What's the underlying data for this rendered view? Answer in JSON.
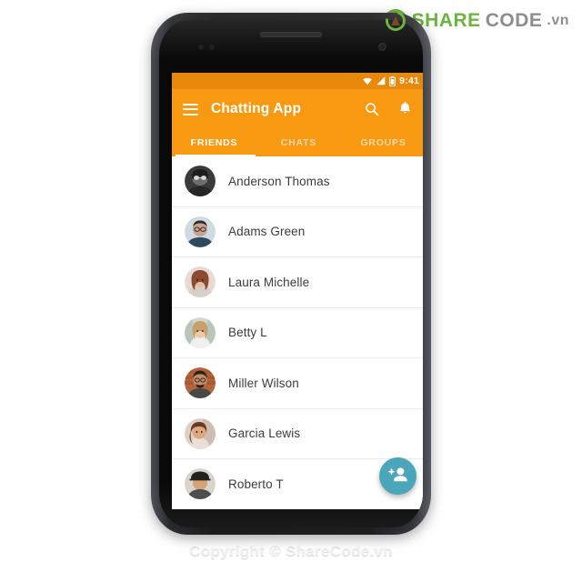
{
  "watermark": {
    "logo_share": "SHARE",
    "logo_code": "CODE",
    "logo_vn": ".vn",
    "copyright": "Copyright © ShareCode.vn"
  },
  "colors": {
    "appbar": "#f79a12",
    "statusbar": "#e8890c",
    "fab": "#4aa6b8",
    "accent_green": "#6cb33f",
    "list_text": "#3c3c3c"
  },
  "statusbar": {
    "time": "9:41",
    "icons": [
      "wifi-icon",
      "signal-icon",
      "battery-icon"
    ]
  },
  "appbar": {
    "menu_icon": "hamburger-menu-icon",
    "title": "Chatting App",
    "search_icon": "search-icon",
    "notification_icon": "bell-icon"
  },
  "tabs": [
    {
      "label": "FRIENDS",
      "active": true
    },
    {
      "label": "CHATS",
      "active": false
    },
    {
      "label": "GROUPS",
      "active": false
    }
  ],
  "friends": [
    {
      "name": "Anderson Thomas",
      "avatar": "avatar-anderson-thomas"
    },
    {
      "name": "Adams Green",
      "avatar": "avatar-adams-green"
    },
    {
      "name": "Laura Michelle",
      "avatar": "avatar-laura-michelle"
    },
    {
      "name": "Betty L",
      "avatar": "avatar-betty-l"
    },
    {
      "name": "Miller Wilson",
      "avatar": "avatar-miller-wilson"
    },
    {
      "name": "Garcia Lewis",
      "avatar": "avatar-garcia-lewis"
    },
    {
      "name": "Roberto T",
      "avatar": "avatar-roberto-t"
    }
  ],
  "fab": {
    "icon": "person-add-icon"
  }
}
